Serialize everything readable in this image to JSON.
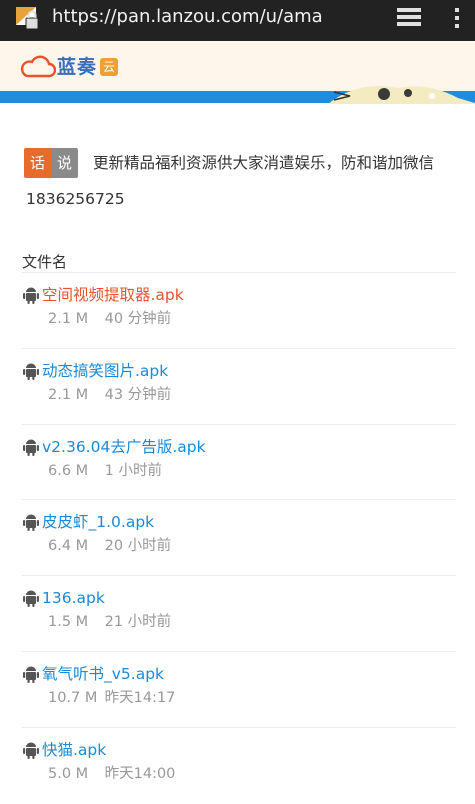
{
  "browser": {
    "url": "https://pan.lanzou.com/u/ama"
  },
  "site": {
    "logo_text": "蓝奏",
    "logo_badge": "云",
    "accent_color": "#1f8ddf"
  },
  "notice": {
    "badge_left": "话",
    "badge_right": "说",
    "line1": "更新精品福利资源供大家消遣娱乐，防和谐加微信",
    "line2": "1836256725"
  },
  "list": {
    "header": "文件名",
    "files": [
      {
        "name": "空间视频提取器.apk",
        "size": "2.1 M",
        "time": "40 分钟前"
      },
      {
        "name": "动态搞笑图片.apk",
        "size": "2.1 M",
        "time": "43 分钟前"
      },
      {
        "name": "v2.36.04去广告版.apk",
        "size": "6.6 M",
        "time": "1 小时前"
      },
      {
        "name": "皮皮虾_1.0.apk",
        "size": "6.4 M",
        "time": "20 小时前"
      },
      {
        "name": "136.apk",
        "size": "1.5 M",
        "time": "21 小时前"
      },
      {
        "name": "氧气听书_v5.apk",
        "size": "10.7 M",
        "time": "昨天14:17"
      },
      {
        "name": "快猫.apk",
        "size": "5.0 M",
        "time": "昨天14:00"
      }
    ]
  }
}
